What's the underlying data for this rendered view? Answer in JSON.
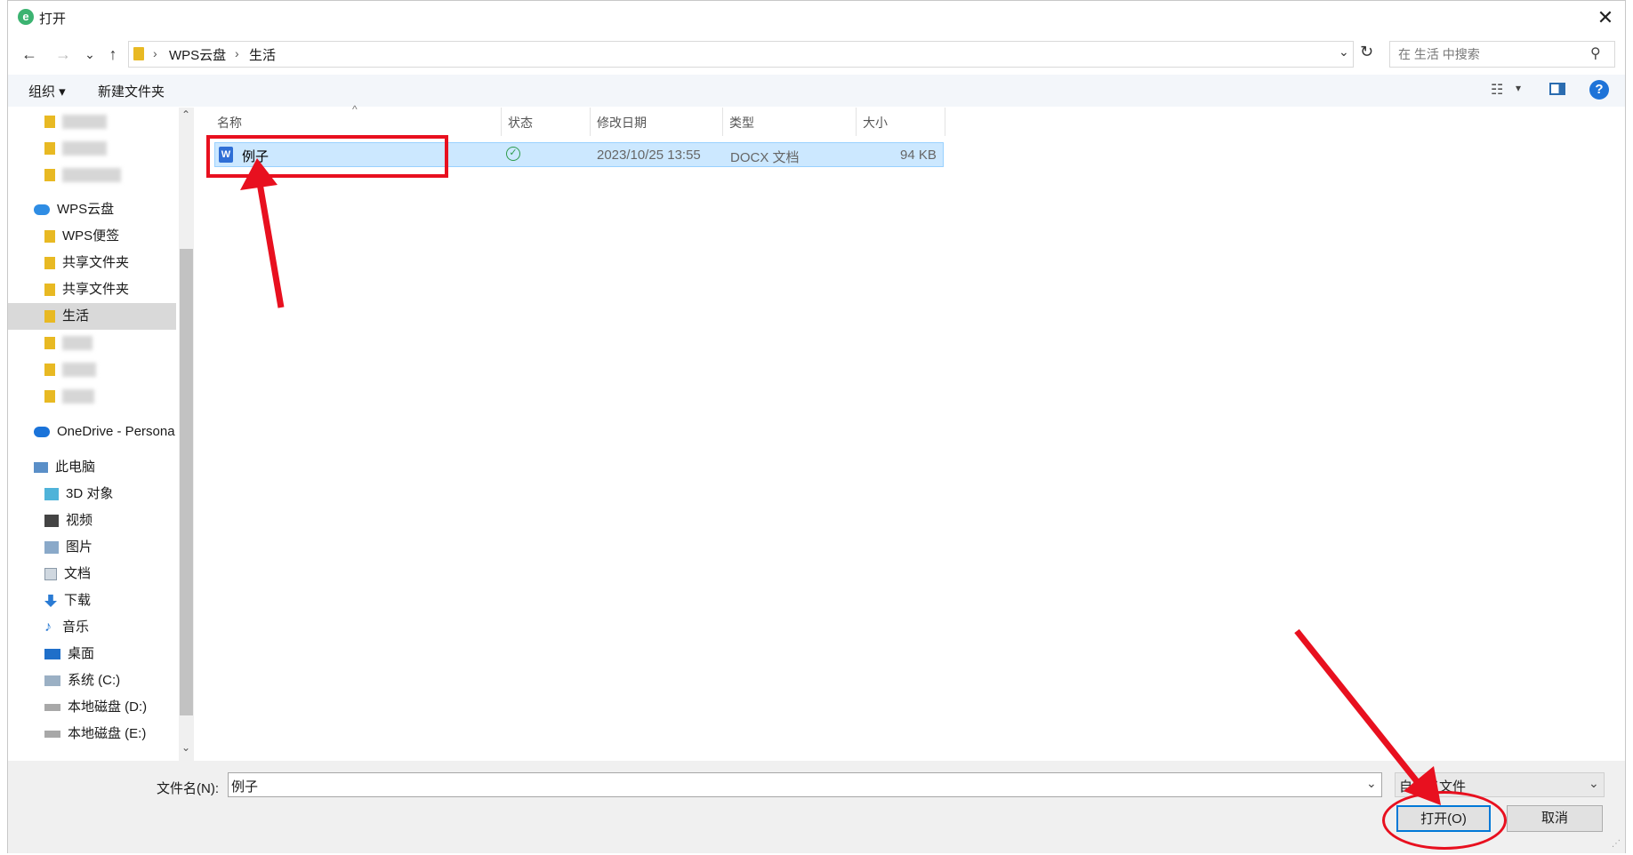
{
  "title_bar": {
    "title": "打开",
    "close_glyph": "✕"
  },
  "nav": {
    "back": "←",
    "forward": "→",
    "recent": "⌄",
    "up": "↑"
  },
  "address_bar": {
    "crumbs": [
      "WPS云盘",
      "生活"
    ],
    "separator": "›",
    "dropdown_glyph": "⌄",
    "refresh_glyph": "↻"
  },
  "search": {
    "placeholder": "在 生活 中搜索",
    "icon_glyph": "⚲"
  },
  "toolbar": {
    "organize": "组织 ▾",
    "new_folder": "新建文件夹",
    "view_glyph": "☷",
    "view_menu_glyph": "▾",
    "help": "?"
  },
  "sidebar": {
    "items": [
      {
        "label": "",
        "blurred": true
      },
      {
        "label": "",
        "blurred": true
      },
      {
        "label": "",
        "blurred": true
      },
      {
        "label": "WPS云盘"
      },
      {
        "label": "WPS便签"
      },
      {
        "label": "共享文件夹"
      },
      {
        "label": "共享文件夹"
      },
      {
        "label": "生活",
        "selected": true
      },
      {
        "label": "",
        "blurred": true
      },
      {
        "label": "",
        "blurred": true
      },
      {
        "label": "",
        "blurred": true
      },
      {
        "label": "OneDrive - Persona"
      },
      {
        "label": "此电脑"
      },
      {
        "label": "3D 对象"
      },
      {
        "label": "视频"
      },
      {
        "label": "图片"
      },
      {
        "label": "文档"
      },
      {
        "label": "下载"
      },
      {
        "label": "音乐"
      },
      {
        "label": "桌面"
      },
      {
        "label": "系统 (C:)"
      },
      {
        "label": "本地磁盘 (D:)"
      },
      {
        "label": "本地磁盘 (E:)"
      }
    ],
    "scroll_up": "⌃",
    "scroll_down": "⌄"
  },
  "file_list": {
    "sort_indicator": "^",
    "columns": [
      "名称",
      "状态",
      "修改日期",
      "类型",
      "大小"
    ],
    "rows": [
      {
        "name": "例子",
        "status_glyph": "✓",
        "modified": "2023/10/25 13:55",
        "type": "DOCX 文档",
        "size": "94 KB"
      }
    ]
  },
  "bottom": {
    "filename_label": "文件名(N):",
    "filename_value": "例子",
    "filetype_value": "自定义文件",
    "dropdown_glyph": "⌄",
    "open_button": "打开(O)",
    "cancel_button": "取消"
  },
  "colors": {
    "accent": "#0078d7",
    "selection": "#cce8ff",
    "annotation": "#e8101f",
    "folder": "#e8b923"
  }
}
